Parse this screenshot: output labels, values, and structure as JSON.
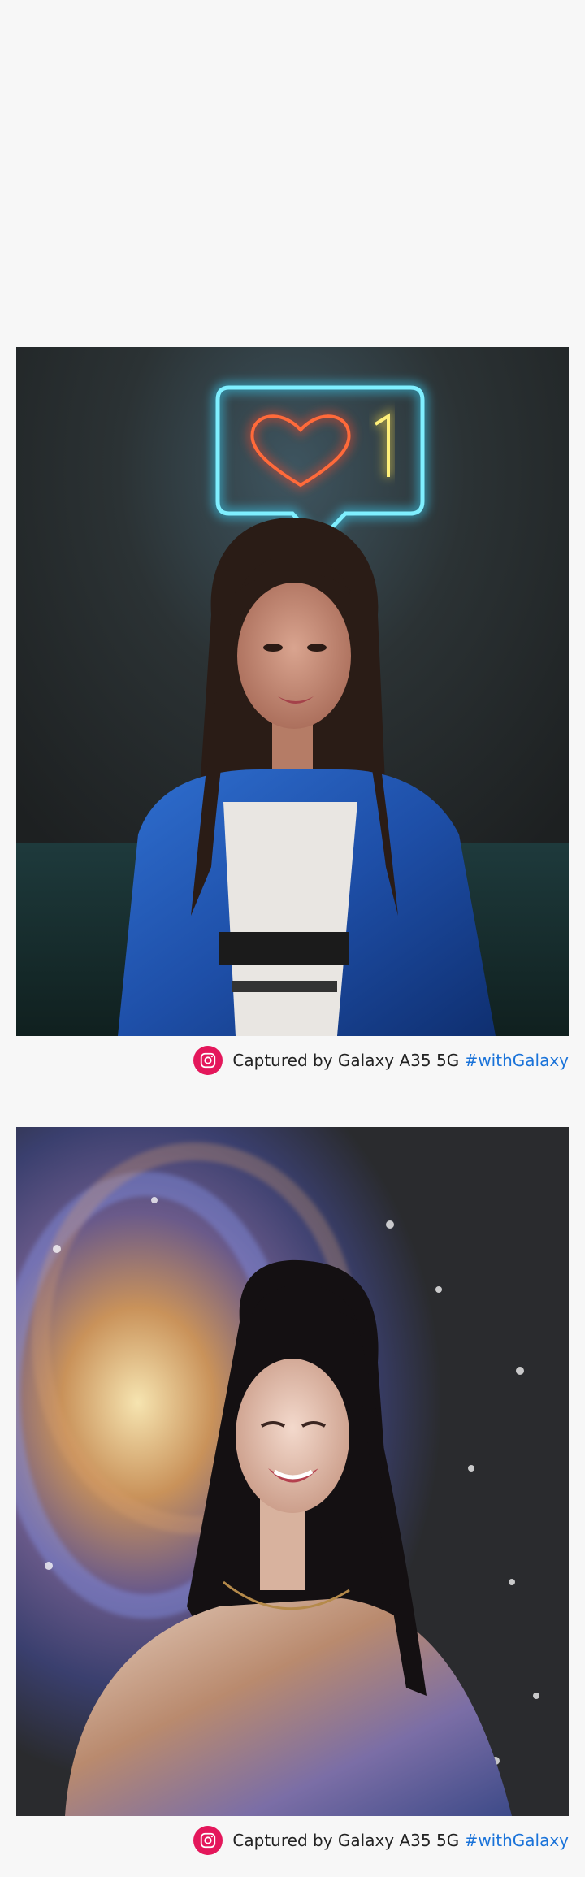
{
  "photos": [
    {
      "alt_subject": "portrait-neon-heart",
      "caption": {
        "text": "Captured by Galaxy A35 5G",
        "hashtag": "#withGalaxy"
      },
      "neon_counter": "1"
    },
    {
      "alt_subject": "portrait-galaxy-projection",
      "caption": {
        "text": "Captured by Galaxy A35 5G",
        "hashtag": "#withGalaxy"
      }
    }
  ],
  "colors": {
    "background": "#f7f7f7",
    "instagram_badge": "#e4175b",
    "hashtag": "#1a73d9",
    "caption_text": "#222222"
  },
  "icons": {
    "caption_icon": "instagram-icon"
  }
}
